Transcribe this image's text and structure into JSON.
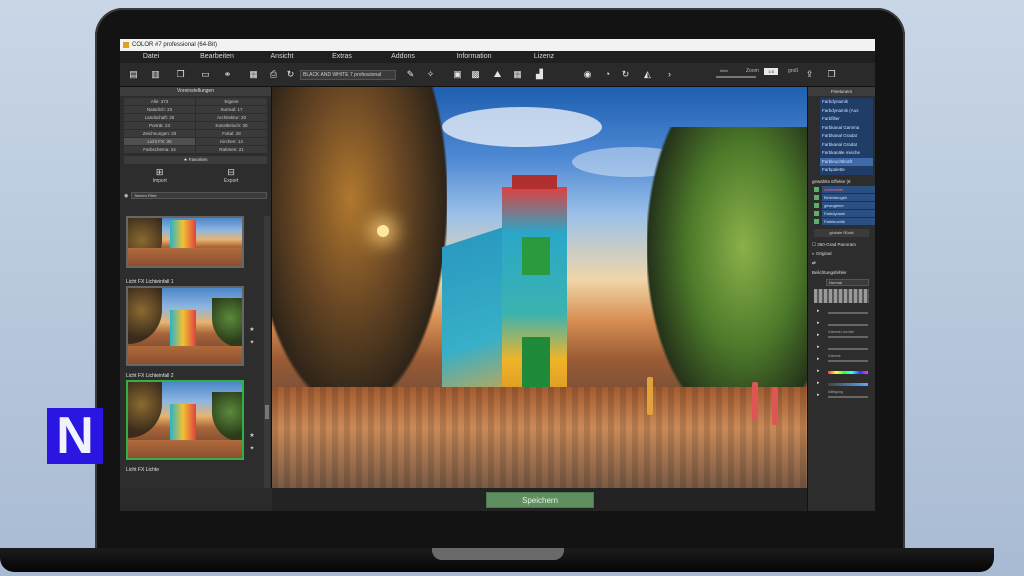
{
  "window": {
    "title": "COLOR #7 professional (64-Bit)"
  },
  "menu": [
    "Datei",
    "Bearbeiten",
    "Ansicht",
    "Extras",
    "Addons",
    "Information",
    "Lizenz"
  ],
  "toolbar": {
    "preset_select": "BLACK AND WHITE 7 professional",
    "zoom_label": "Zoom",
    "zoom_value": "1:3",
    "zoom_left": "klein",
    "zoom_right": "groß"
  },
  "left_panel": {
    "header": "Voreinstellungen",
    "presets": [
      "Alle: 373",
      "Eigene",
      "Natürlich: 23",
      "Surreal: 17",
      "Landschaft: 25",
      "Architektur: 20",
      "Porträt: 23",
      "Künstlerisch: 30",
      "Zeichnungen: 33",
      "Fokal: 28",
      "Licht FX: 30",
      "Kirchen: 14",
      "Farbschema: 24",
      "Rahmen: 21"
    ],
    "selected_preset_index": 10,
    "favorites": "Favoriten",
    "import": "Import",
    "export": "Export",
    "filter_select": "Seinen Filter",
    "thumbnails": [
      {
        "title": ""
      },
      {
        "title": "Licht FX Lichteinfall 1"
      },
      {
        "title": "Licht FX Lichteinfall 2"
      },
      {
        "title": "Licht FX Lichte"
      }
    ],
    "logo_letter": "N"
  },
  "bottom": {
    "save_label": "Speichern"
  },
  "right_panel": {
    "header": "Finetuners",
    "filters": [
      "Farbdynamik",
      "Farbdynamik (Aus",
      "Farbfilter",
      "Farbkanal Gamma",
      "Farbkanal Gradat",
      "Farbkanal Gradat",
      "Farbkanäle mische",
      "Farbleuchtkraft",
      "Farbpalette"
    ],
    "selected_filter_index": 7,
    "effects_title": "gewählte Effekte (8",
    "effects": [
      "Lichteinfall",
      "Belichtungsb",
      "gewogener",
      "Farbdynami",
      "Farbleuchtk"
    ],
    "global_button": "globale Rückt",
    "panorama": "360-Grad Panoram",
    "original": "Original",
    "exposure_title": "Belichtungsfehler",
    "blend_mode": "Normal",
    "sliders": [
      "",
      "",
      "Gamma Leuchte",
      "",
      "Gamma",
      "",
      "",
      "Sättigung",
      ""
    ]
  }
}
